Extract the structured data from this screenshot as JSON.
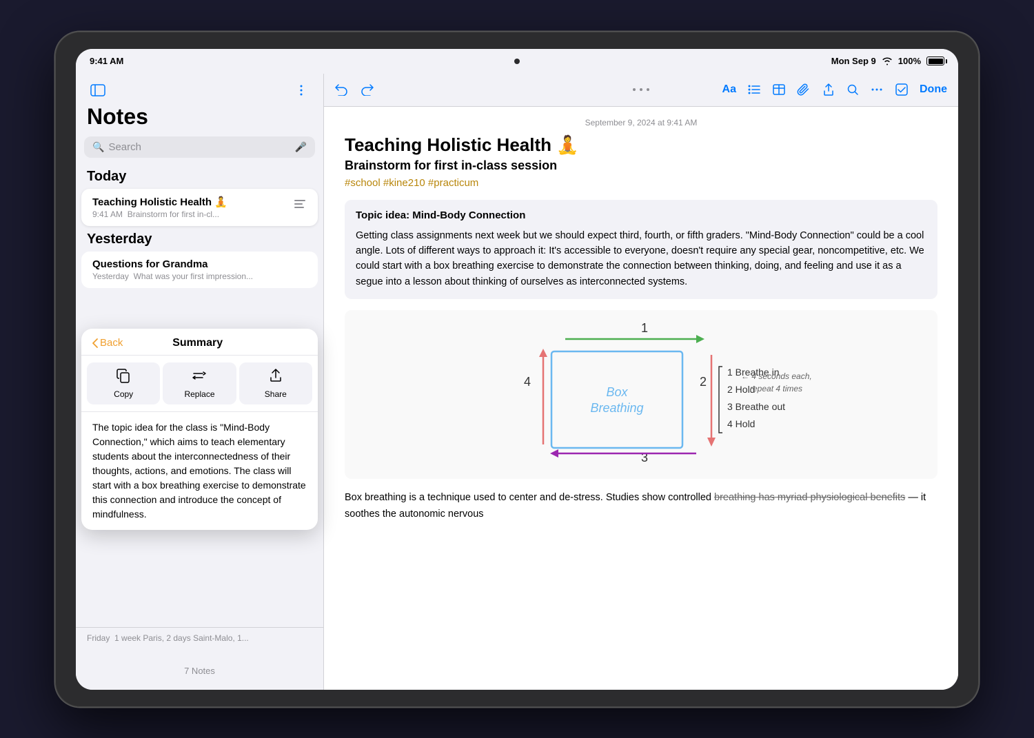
{
  "device": {
    "status_bar": {
      "time": "9:41 AM",
      "date": "Mon Sep 9",
      "wifi_label": "wifi",
      "battery_percent": "100%"
    }
  },
  "sidebar": {
    "title": "Notes",
    "search_placeholder": "Search",
    "today_label": "Today",
    "yesterday_label": "Yesterday",
    "notes_count": "7 Notes",
    "notes": [
      {
        "title": "Teaching Holistic Health 🧘",
        "time": "9:41 AM",
        "preview": "Brainstorm for first in-cl...",
        "active": true
      },
      {
        "title": "Questions for Grandma",
        "time": "Yesterday",
        "preview": "What was your first impression..."
      }
    ],
    "bottom_note": {
      "label": "Friday",
      "text": "1 week Paris, 2 days Saint-Malo, 1..."
    }
  },
  "summary_popup": {
    "back_label": "Back",
    "title": "Summary",
    "actions": [
      {
        "label": "Copy",
        "icon": "copy"
      },
      {
        "label": "Replace",
        "icon": "replace"
      },
      {
        "label": "Share",
        "icon": "share"
      }
    ],
    "content": "The topic idea for the class is \"Mind-Body Connection,\" which aims to teach elementary students about the interconnectedness of their thoughts, actions, and emotions. The class will start with a box breathing exercise to demonstrate this connection and introduce the concept of mindfulness."
  },
  "editor": {
    "toolbar_dots": "···",
    "done_label": "Done",
    "note_date": "September 9, 2024 at 9:41 AM",
    "title": "Teaching Holistic Health 🧘",
    "subtitle": "Brainstorm for first in-class session",
    "tags": "#school #kine210 #practicum",
    "topic_title": "Topic idea: Mind-Body Connection",
    "topic_body": "Getting class assignments next week but we should expect third, fourth, or fifth graders. \"Mind-Body Connection\" could be a cool angle. Lots of different ways to approach it: It's accessible to everyone, doesn't require any special gear, noncompetitive, etc. We could start with a box breathing exercise to demonstrate the connection between thinking, doing, and feeling and use it as a segue into a lesson about thinking of ourselves as interconnected systems.",
    "body_text": "Box breathing is a technique used to center and de-stress. Studies show controlled breathing has myriad physiological benefits — it soothes the autonomic nervous",
    "body_text_strikethrough": "breathing has myriad physiological benefits"
  }
}
